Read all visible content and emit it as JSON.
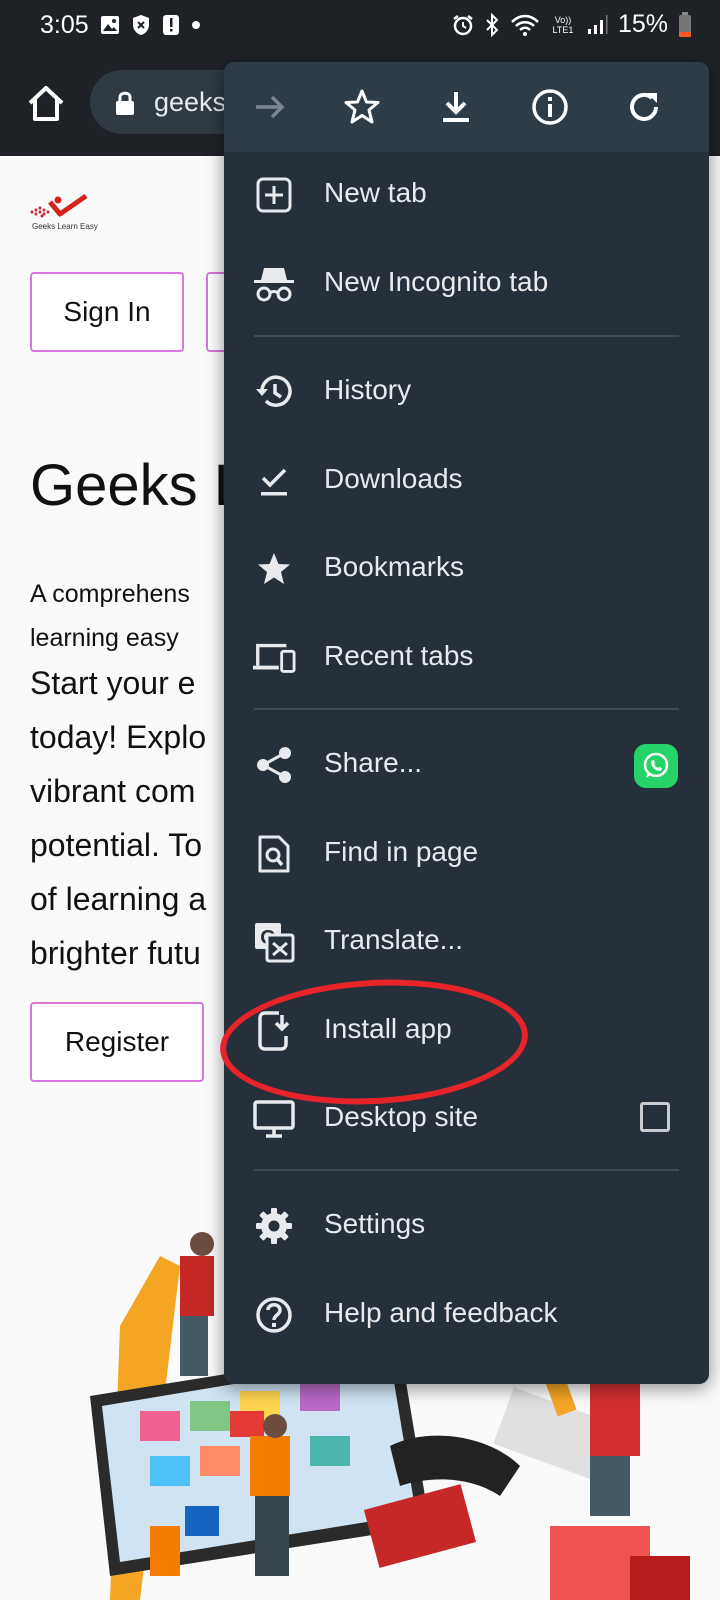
{
  "status_bar": {
    "time": "3:05",
    "battery": "15%",
    "volte": "Vo)) LTE1"
  },
  "toolbar": {
    "url": "geeks"
  },
  "page": {
    "logo_text": "Geeks Learn Easy",
    "signin_label": "Sign In",
    "title": "Geeks L",
    "para1_line1": "A comprehens",
    "para1_line2": "learning easy",
    "para2_lines": [
      "Start your e",
      "today!  Explo",
      "vibrant com",
      "potential. To",
      "of learning a",
      "brighter futu"
    ],
    "register_label": "Register"
  },
  "menu": {
    "items": [
      {
        "label": "New tab",
        "icon": "plus-box-icon"
      },
      {
        "label": "New Incognito tab",
        "icon": "incognito-icon"
      },
      {
        "label": "History",
        "icon": "history-icon"
      },
      {
        "label": "Downloads",
        "icon": "download-check-icon"
      },
      {
        "label": "Bookmarks",
        "icon": "star-icon"
      },
      {
        "label": "Recent tabs",
        "icon": "devices-icon"
      },
      {
        "label": "Share...",
        "icon": "share-icon"
      },
      {
        "label": "Find in page",
        "icon": "find-in-page-icon"
      },
      {
        "label": "Translate...",
        "icon": "translate-icon"
      },
      {
        "label": "Install app",
        "icon": "install-app-icon"
      },
      {
        "label": "Desktop site",
        "icon": "desktop-icon"
      },
      {
        "label": "Settings",
        "icon": "gear-icon"
      },
      {
        "label": "Help and feedback",
        "icon": "help-icon"
      }
    ]
  },
  "colors": {
    "menu_bg": "#25303a",
    "accent_pink": "#d777d9",
    "highlight_red": "#e8242b",
    "whatsapp": "#25d366"
  }
}
